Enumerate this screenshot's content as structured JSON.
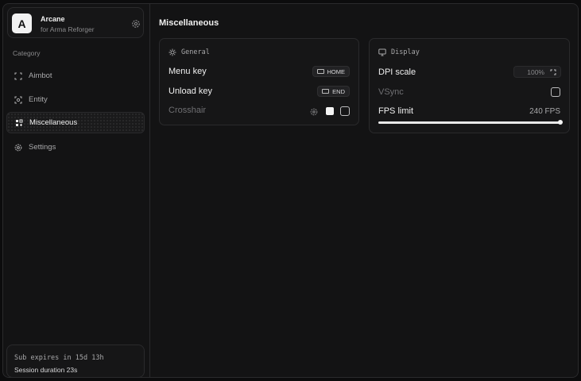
{
  "app": {
    "name": "Arcane",
    "subtitle": "for Arma Reforger",
    "logo_letter": "A"
  },
  "sidebar": {
    "category_label": "Category",
    "items": [
      {
        "label": "Aimbot",
        "icon": "crosshair-frame-icon",
        "active": false
      },
      {
        "label": "Entity",
        "icon": "scan-user-icon",
        "active": false
      },
      {
        "label": "Miscellaneous",
        "icon": "puzzle-icon",
        "active": true
      },
      {
        "label": "Settings",
        "icon": "gear-icon",
        "active": false
      }
    ],
    "footer": {
      "sub_expires": "Sub expires in 15d 13h",
      "session": "Session duration 23s"
    }
  },
  "main": {
    "title": "Miscellaneous",
    "general": {
      "header": "General",
      "menu_key": {
        "label": "Menu key",
        "key": "HOME"
      },
      "unload_key": {
        "label": "Unload key",
        "key": "END"
      },
      "crosshair": {
        "label": "Crosshair",
        "enabled": false,
        "color": "#f4f4f4"
      }
    },
    "display": {
      "header": "Display",
      "dpi": {
        "label": "DPI scale",
        "value": "100%"
      },
      "vsync": {
        "label": "VSync",
        "enabled": false
      },
      "fps": {
        "label": "FPS limit",
        "value": "240 FPS",
        "fraction": 1.0
      }
    }
  },
  "colors": {
    "bg": "#131314",
    "border": "#2a2a2c",
    "text": "#f0f0f0",
    "muted": "#8a8a8c"
  }
}
